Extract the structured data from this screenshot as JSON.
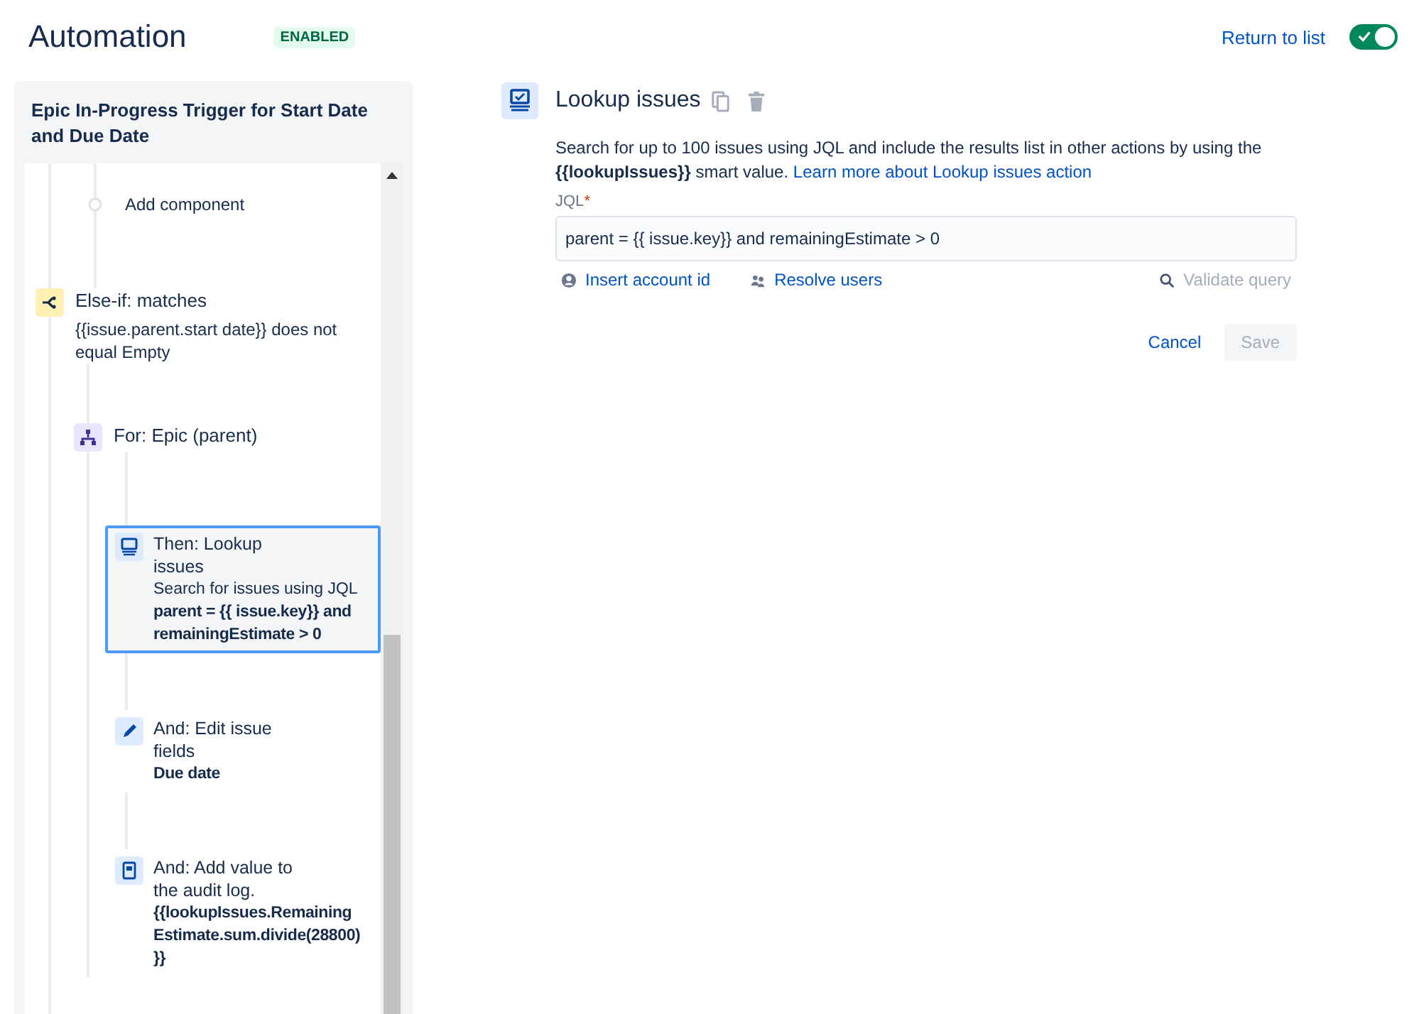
{
  "header": {
    "title": "Automation",
    "status": "ENABLED",
    "return_link": "Return to list",
    "toggle": {
      "on": true
    }
  },
  "rule": {
    "title": "Epic In-Progress Trigger for Start Date and Due Date",
    "steps": [
      {
        "kind": "add",
        "title": "Add component"
      },
      {
        "kind": "condition",
        "title": "Else-if: matches",
        "detail": "{{issue.parent.start date}} does not equal Empty",
        "children": [
          {
            "kind": "branch",
            "title": "For: Epic (parent)",
            "children": [
              {
                "kind": "lookup",
                "title": "Then: Lookup issues",
                "selected": true,
                "lines": [
                  "Search for issues using JQL"
                ],
                "bold": "parent = {{ issue.key}} and remainingEstimate > 0"
              },
              {
                "kind": "edit",
                "title": "And: Edit issue fields",
                "selected": false,
                "bold": "Due date"
              },
              {
                "kind": "log",
                "title": "And: Add value to the audit log.",
                "selected": false,
                "bold": "{{lookupIssues.Remaining Estimate.sum.divide(28800) }}"
              }
            ]
          }
        ]
      }
    ]
  },
  "panel": {
    "title": "Lookup issues",
    "description": "Search for up to 100 issues using JQL and include the results list in other actions by using the **{{lookupIssues}}** smart value.",
    "learn_link": "Learn more about Lookup issues action",
    "field_label": "JQL",
    "required_mark": "*",
    "jql": "parent = {{ issue.key}} and remainingEstimate > 0",
    "insert_link": "Insert account id",
    "resolve_link": "Resolve users",
    "validate": {
      "label": "Validate query",
      "disabled": true
    },
    "cancel": "Cancel",
    "save": {
      "label": "Save",
      "disabled": true
    }
  }
}
